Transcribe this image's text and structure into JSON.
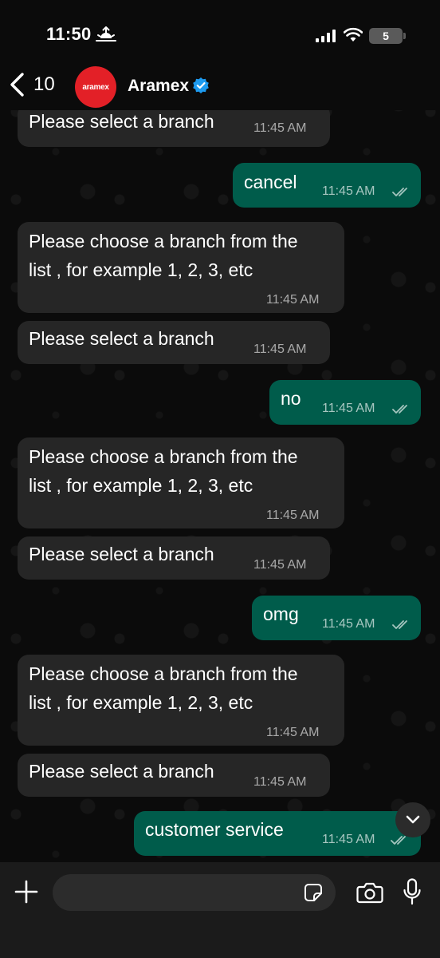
{
  "status_bar": {
    "time": "11:50",
    "battery": "5"
  },
  "header": {
    "unread_count": "10",
    "avatar_text": "aramex",
    "contact_name": "Aramex"
  },
  "messages": [
    {
      "dir": "in",
      "text": "Please select a branch",
      "time": "11:45 AM"
    },
    {
      "dir": "out",
      "text": "cancel",
      "time": "11:45 AM"
    },
    {
      "dir": "in",
      "text": "Please choose a branch from the\nlist , for example 1, 2, 3, etc",
      "time": "11:45 AM"
    },
    {
      "dir": "in",
      "text": "Please select a branch",
      "time": "11:45 AM"
    },
    {
      "dir": "out",
      "text": "no",
      "time": "11:45 AM"
    },
    {
      "dir": "in",
      "text": "Please choose a branch from the\nlist , for example 1, 2, 3, etc",
      "time": "11:45 AM"
    },
    {
      "dir": "in",
      "text": "Please select a branch",
      "time": "11:45 AM"
    },
    {
      "dir": "out",
      "text": "omg",
      "time": "11:45 AM"
    },
    {
      "dir": "in",
      "text": "Please choose a branch from the\nlist , for example 1, 2, 3, etc",
      "time": "11:45 AM"
    },
    {
      "dir": "in",
      "text": "Please select a branch",
      "time": "11:45 AM"
    },
    {
      "dir": "out",
      "text": "customer service",
      "time": "11:45 AM"
    }
  ],
  "composer": {
    "placeholder": ""
  },
  "colors": {
    "incoming_bubble": "#262626",
    "outgoing_bubble": "#005c4b",
    "brand_red": "#e32027",
    "verified_blue": "#1d9bf0"
  }
}
